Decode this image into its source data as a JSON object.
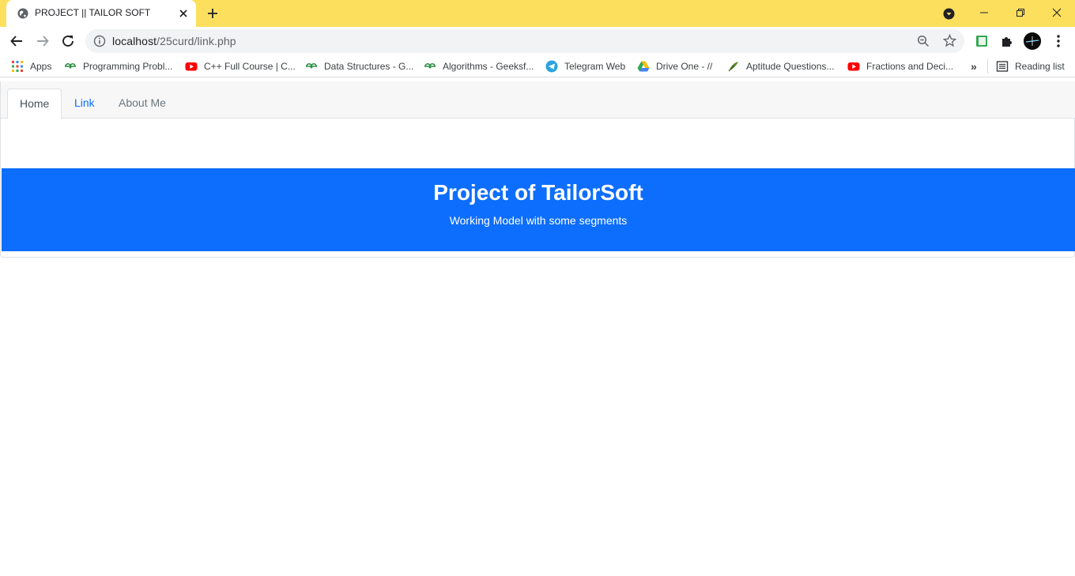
{
  "browser": {
    "tab": {
      "title": "PROJECT || TAILOR SOFT",
      "favicon": "globe-icon"
    },
    "address_bar": {
      "host": "localhost",
      "path": "/25curd/link.php"
    },
    "bookmarks": [
      {
        "label": "Apps",
        "icon": "apps-grid-icon"
      },
      {
        "label": "Programming Probl...",
        "icon": "geeksforgeeks-icon"
      },
      {
        "label": "C++ Full Course | C...",
        "icon": "youtube-icon"
      },
      {
        "label": "Data Structures - G...",
        "icon": "geeksforgeeks-icon"
      },
      {
        "label": "Algorithms - Geeksf...",
        "icon": "geeksforgeeks-icon"
      },
      {
        "label": "Telegram Web",
        "icon": "telegram-icon"
      },
      {
        "label": "Drive One - //",
        "icon": "google-drive-icon"
      },
      {
        "label": "Aptitude Questions...",
        "icon": "aptitude-icon"
      },
      {
        "label": "Fractions and Deci...",
        "icon": "youtube-icon"
      }
    ],
    "reading_list": "Reading list",
    "overflow": "»"
  },
  "nav": {
    "tabs": [
      {
        "label": "Home",
        "state": "active"
      },
      {
        "label": "Link",
        "state": "link"
      },
      {
        "label": "About Me",
        "state": "inactive"
      }
    ]
  },
  "hero": {
    "title": "Project of TailorSoft",
    "subtitle": "Working Model with some segments"
  },
  "colors": {
    "titlebar": "#fddf5e",
    "primary": "#0d6efd",
    "nav_bg": "#f7f7f7"
  }
}
